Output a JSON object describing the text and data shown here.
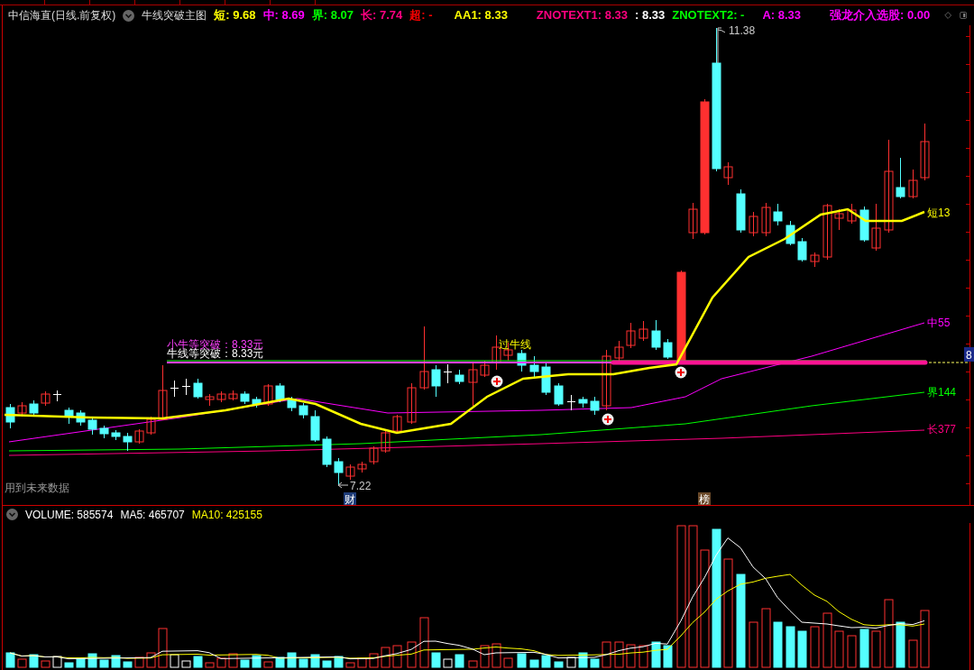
{
  "header": {
    "security": "中信海直(日线.前复权)",
    "indicator": "牛线突破主图",
    "values": [
      {
        "text": "短: 9.68",
        "color": "#ffff00"
      },
      {
        "text": "中: 8.69",
        "color": "#ff00ff"
      },
      {
        "text": "界: 8.07",
        "color": "#00ff00"
      },
      {
        "text": "长: 7.74",
        "color": "#ff0080"
      },
      {
        "text": "超: -",
        "color": "#ff0000"
      },
      {
        "text": "AA1: 8.33",
        "color": "#ffff00"
      },
      {
        "text": "ZNOTEXT1: 8.33",
        "color": "#ff0080"
      },
      {
        "text": ": 8.33",
        "color": "#ffffff"
      },
      {
        "text": "ZNOTEXT2: -",
        "color": "#00ff00"
      },
      {
        "text": "A: 8.33",
        "color": "#ff00ff"
      },
      {
        "text": "强龙介入选股: 0.00",
        "color": "#ff00ff"
      }
    ]
  },
  "price_chart": {
    "high_label": "11.38",
    "low_label": "7.22",
    "signal_text": "过牛线",
    "break_texts": [
      "小牛等突破：8.33元",
      "牛线等突破：8.33元"
    ],
    "note": "用到未来数据",
    "price_tag": "8",
    "line_labels": [
      {
        "text": "短13",
        "color": "#ffff00"
      },
      {
        "text": "中55",
        "color": "#ff00ff"
      },
      {
        "text": "界144",
        "color": "#00ff00"
      },
      {
        "text": "长377",
        "color": "#ff0080"
      }
    ],
    "markers": [
      {
        "text": "财",
        "kind": "finance"
      },
      {
        "text": "榜",
        "kind": "list"
      }
    ]
  },
  "volume_chart": {
    "values": [
      {
        "text": "VOLUME: 585574",
        "color": "#ffffff"
      },
      {
        "text": "MA5: 465707",
        "color": "#ffffff"
      },
      {
        "text": "MA10: 425155",
        "color": "#ffff00"
      }
    ]
  }
}
